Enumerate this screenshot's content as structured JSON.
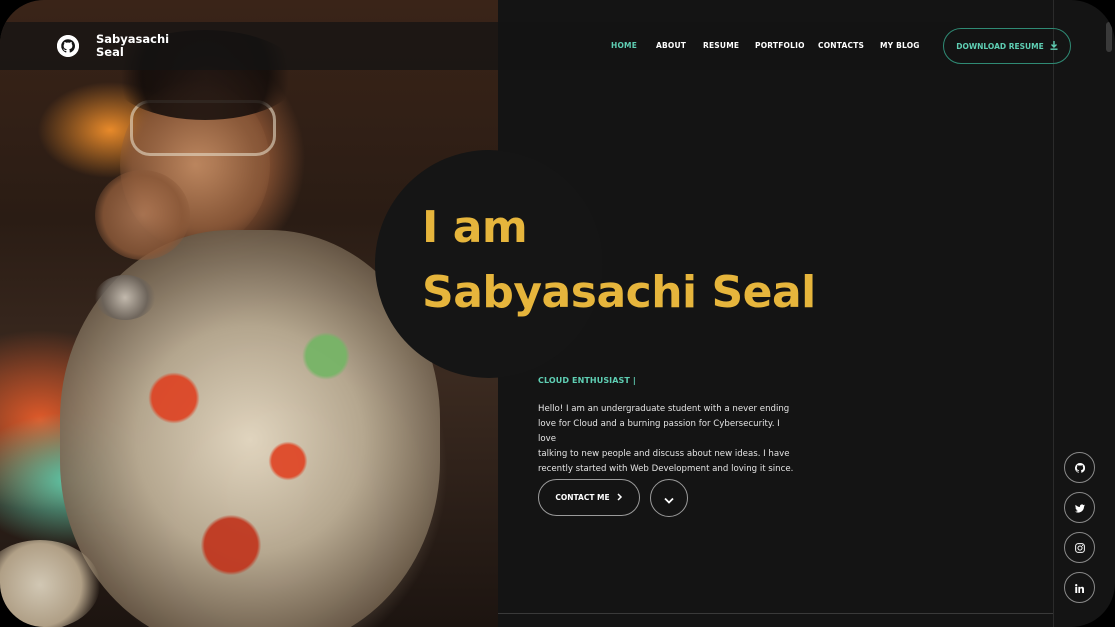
{
  "header": {
    "brand_line1": "Sabyasachi",
    "brand_line2": "Seal",
    "logo_icon": "github-icon"
  },
  "nav": {
    "items": [
      {
        "label": "HOME",
        "active": true
      },
      {
        "label": "ABOUT",
        "active": false
      },
      {
        "label": "RESUME",
        "active": false
      },
      {
        "label": "PORTFOLIO",
        "active": false
      },
      {
        "label": "CONTACTS",
        "active": false
      },
      {
        "label": "MY BLOG",
        "active": false
      }
    ],
    "download_label": "DOWNLOAD RESUME",
    "download_icon": "download-icon"
  },
  "hero": {
    "heading_line1": "I am",
    "heading_line2": "Sabyasachi Seal",
    "tagline": "CLOUD ENTHUSIAST |",
    "bio_lines": [
      "Hello! I am an undergraduate student with a never ending",
      "love for Cloud and a burning passion for Cybersecurity. I love",
      "talking to new people and discuss about new ideas. I have",
      "recently started with Web Development and loving it since."
    ],
    "contact_label": "CONTACT ME",
    "contact_icon": "chevron-right-icon",
    "scroll_icon": "chevron-down-icon"
  },
  "social": [
    {
      "name": "github-icon"
    },
    {
      "name": "twitter-icon"
    },
    {
      "name": "instagram-icon"
    },
    {
      "name": "linkedin-icon"
    }
  ],
  "colors": {
    "accent": "#5fcfb4",
    "heading": "#e6b53c",
    "background": "#141414"
  }
}
